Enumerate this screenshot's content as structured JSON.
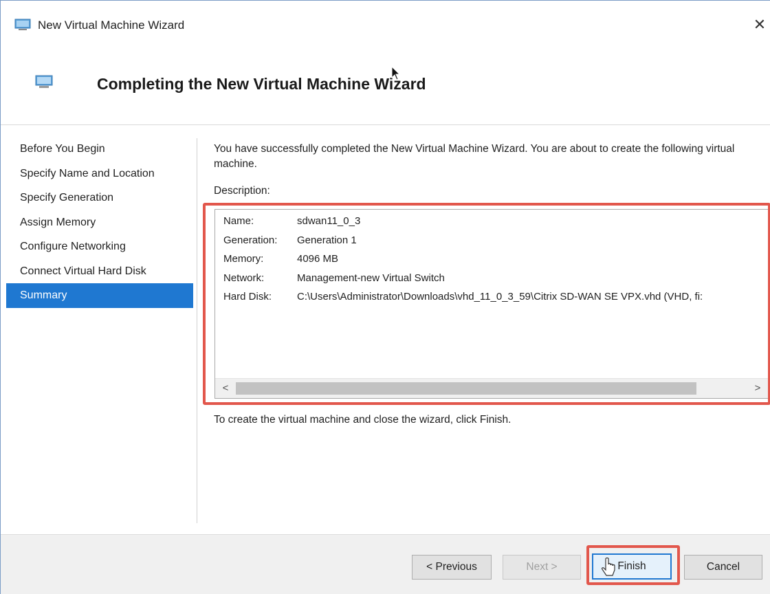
{
  "window": {
    "title": "New Virtual Machine Wizard",
    "close_glyph": "✕"
  },
  "header": {
    "title": "Completing the New Virtual Machine Wizard",
    "icon": "virtual-machine-icon"
  },
  "nav": {
    "items": [
      {
        "label": "Before You Begin",
        "active": false
      },
      {
        "label": "Specify Name and Location",
        "active": false
      },
      {
        "label": "Specify Generation",
        "active": false
      },
      {
        "label": "Assign Memory",
        "active": false
      },
      {
        "label": "Configure Networking",
        "active": false
      },
      {
        "label": "Connect Virtual Hard Disk",
        "active": false
      },
      {
        "label": "Summary",
        "active": true
      }
    ]
  },
  "content": {
    "intro": "You have successfully completed the New Virtual Machine Wizard. You are about to create the following virtual machine.",
    "description_label": "Description:",
    "details": [
      {
        "key": "Name:",
        "value": "sdwan11_0_3"
      },
      {
        "key": "Generation:",
        "value": "Generation 1"
      },
      {
        "key": "Memory:",
        "value": "4096 MB"
      },
      {
        "key": "Network:",
        "value": "Management-new Virtual Switch"
      },
      {
        "key": "Hard Disk:",
        "value": "C:\\Users\\Administrator\\Downloads\\vhd_11_0_3_59\\Citrix SD-WAN SE VPX.vhd (VHD, fi:"
      }
    ],
    "scroll_left": "<",
    "scroll_right": ">",
    "finish_hint": "To create the virtual machine and close the wizard, click Finish."
  },
  "footer": {
    "previous_label": "< Previous",
    "next_label": "Next >",
    "finish_label": "Finish",
    "cancel_label": "Cancel"
  },
  "colors": {
    "accent": "#1f78d1",
    "highlight": "#e2574c"
  }
}
